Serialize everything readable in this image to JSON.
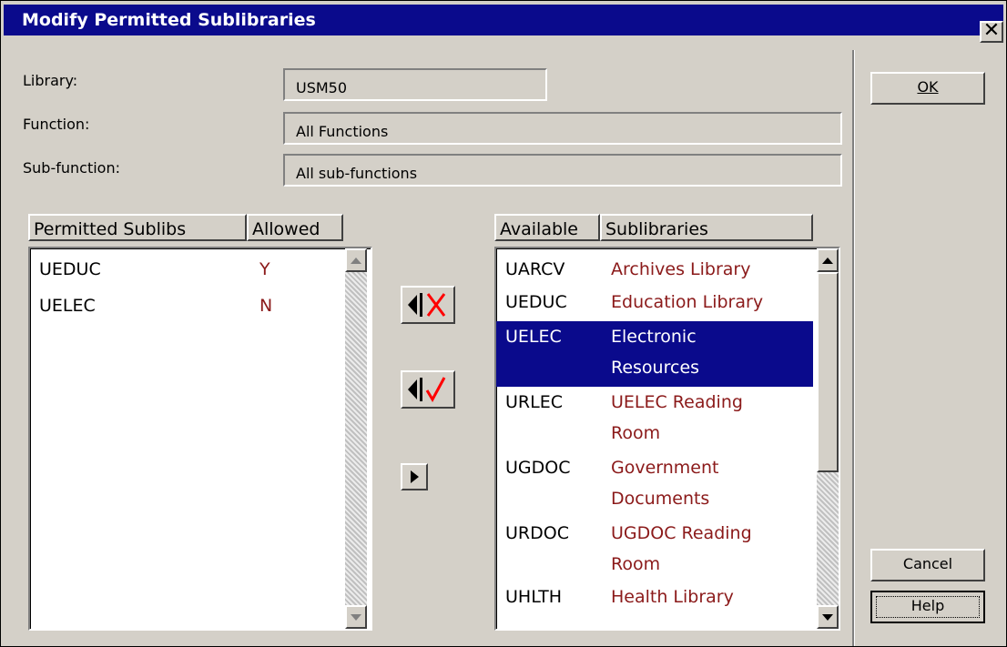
{
  "window": {
    "title": "Modify Permitted Sublibraries",
    "close_glyph": "✕"
  },
  "form": {
    "library_label": "Library:",
    "library_value": "USM50",
    "function_label": "Function:",
    "function_value": "All Functions",
    "subfunction_label": "Sub-function:",
    "subfunction_value": "All sub-functions"
  },
  "permitted": {
    "col1": "Permitted Sublibs",
    "col2": "Allowed",
    "rows": [
      {
        "code": "UEDUC",
        "allowed": "Y"
      },
      {
        "code": "UELEC",
        "allowed": "N"
      }
    ]
  },
  "available": {
    "col1": "Available",
    "col2": "Sublibraries",
    "rows": [
      {
        "code": "UARCV",
        "name1": "Archives Library",
        "name2": ""
      },
      {
        "code": "UEDUC",
        "name1": "Education Library",
        "name2": ""
      },
      {
        "code": "UELEC",
        "name1": "Electronic",
        "name2": "Resources",
        "selected": true
      },
      {
        "code": "URLEC",
        "name1": "UELEC Reading",
        "name2": "Room"
      },
      {
        "code": "UGDOC",
        "name1": "Government",
        "name2": "Documents"
      },
      {
        "code": "URDOC",
        "name1": "UGDOC Reading",
        "name2": "Room"
      },
      {
        "code": "UHLTH",
        "name1": "Health Library",
        "name2": ""
      }
    ]
  },
  "buttons": {
    "ok": "OK",
    "cancel": "Cancel",
    "help": "Help"
  },
  "colors": {
    "title_bar": "#0a0a8c",
    "selection": "#0a0a8c",
    "value_text": "#8b1a1a",
    "icon_red": "#ff0000"
  },
  "icons": [
    "close-icon",
    "move-left-deny-icon",
    "move-left-allow-icon",
    "move-right-icon",
    "scroll-up-icon",
    "scroll-down-icon"
  ]
}
